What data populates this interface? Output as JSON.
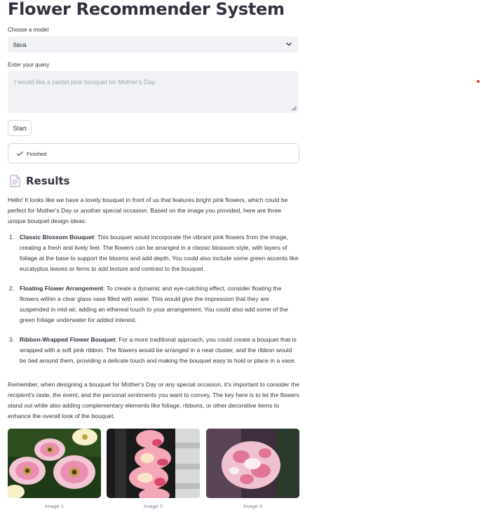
{
  "app": {
    "title": "Flower Recommender System"
  },
  "model_select": {
    "label": "Choose a model",
    "value": "llava"
  },
  "query": {
    "label": "Enter your query",
    "placeholder": "I would like a pastel pink bouquet for Mother's Day."
  },
  "start_button": {
    "label": "Start"
  },
  "status": {
    "text": "Finished"
  },
  "results": {
    "heading": "Results",
    "intro": "Hello! It looks like we have a lovely bouquet in front of us that features bright pink flowers, which could be perfect for Mother's Day or another special occasion. Based on the image you provided, here are three unique bouquet design ideas:",
    "ideas": [
      {
        "number": "1.",
        "title": "Classic Blossom Bouquet",
        "text": ": This bouquet would incorporate the vibrant pink flowers from the image, creating a fresh and lively feel. The flowers can be arranged in a classic blossom style, with layers of foliage at the base to support the blooms and add depth. You could also include some green accents like eucalyptus leaves or ferns to add texture and contrast to the bouquet."
      },
      {
        "number": "2.",
        "title": "Floating Flower Arrangement",
        "text": ": To create a dynamic and eye-catching effect, consider floating the flowers within a clear glass vase filled with water. This would give the impression that they are suspended in mid-air, adding an ethereal touch to your arrangement. You could also add some of the green foliage underwater for added interest."
      },
      {
        "number": "3.",
        "title": "Ribbon-Wrapped Flower Bouquet",
        "text": ": For a more traditional approach, you could create a bouquet that is wrapped with a soft pink ribbon. The flowers would be arranged in a neat cluster, and the ribbon would be tied around them, providing a delicate touch and making the bouquet easy to hold or place in a vase."
      }
    ],
    "outro": "Remember, when designing a bouquet for Mother's Day or any special occasion, it's important to consider the recipient's taste, the event, and the personal sentiments you want to convey. The key here is to let the flowers stand out while also adding complementary elements like foliage, ribbons, or other decorative items to enhance the overall look of the bouquet."
  },
  "gallery": {
    "images": [
      {
        "caption": "Image 1"
      },
      {
        "caption": "Image 2"
      },
      {
        "caption": "Image 3"
      }
    ]
  },
  "colors": {
    "text": "#31333f",
    "input_bg": "#f0f2f6",
    "border": "#d6d6d9",
    "muted": "#808495",
    "accent_dot": "#e53935"
  }
}
